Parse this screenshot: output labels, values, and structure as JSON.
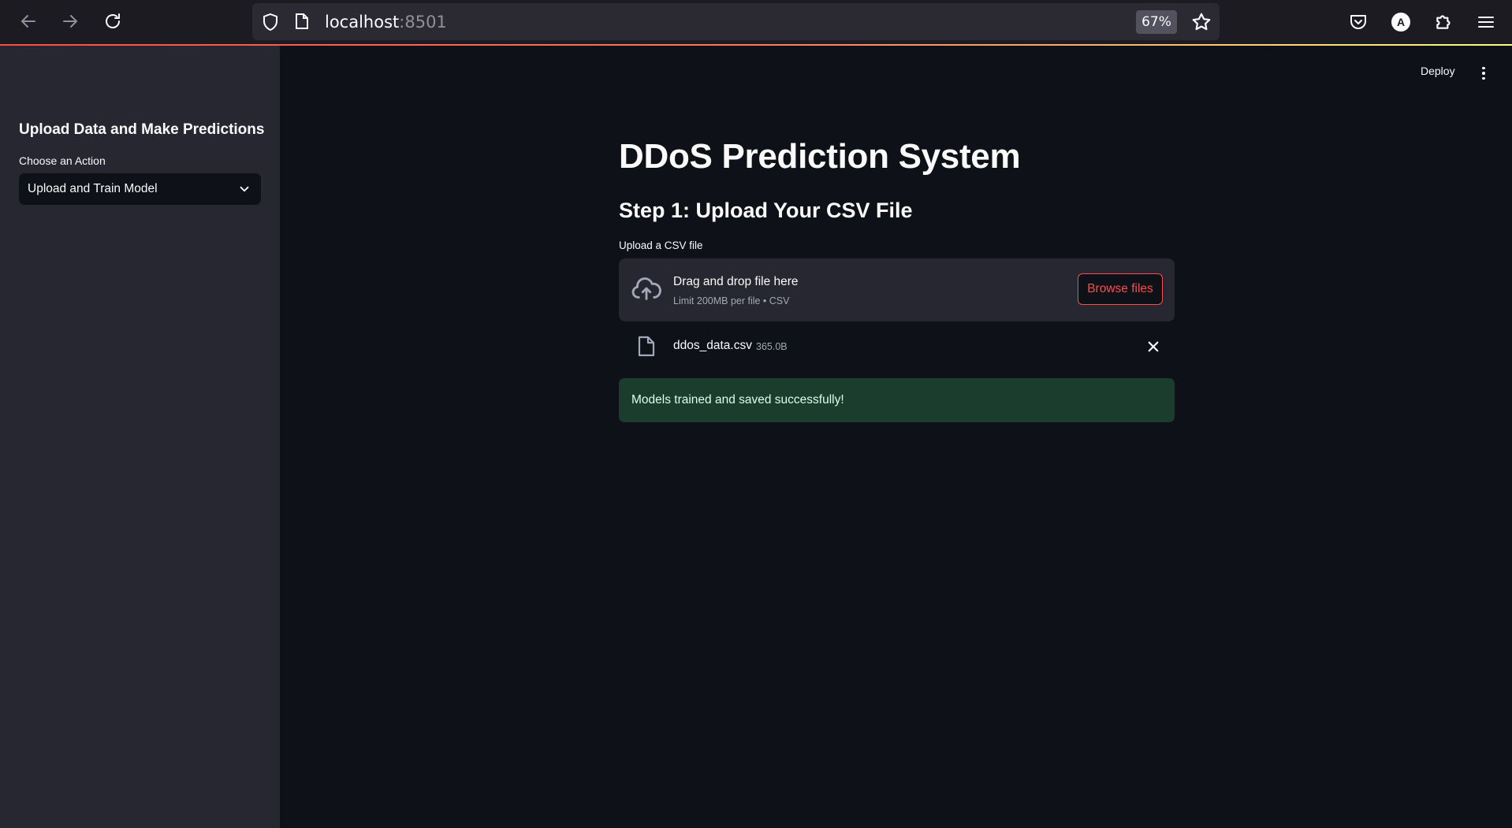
{
  "browser": {
    "url_host": "localhost",
    "url_port": ":8501",
    "zoom": "67%",
    "profile_initial": "A"
  },
  "sidebar": {
    "header": "Upload Data and Make Predictions",
    "select_label": "Choose an Action",
    "select_value": "Upload and Train Model"
  },
  "toolbar": {
    "deploy_label": "Deploy"
  },
  "main": {
    "title": "DDoS Prediction System",
    "step_heading": "Step 1: Upload Your CSV File",
    "uploader_label": "Upload a CSV file",
    "dropzone_title": "Drag and drop file here",
    "dropzone_limit": "Limit 200MB per file • CSV",
    "browse_label": "Browse files",
    "uploaded_file": {
      "name": "ddos_data.csv",
      "size": "365.0B"
    },
    "success_message": "Models trained and saved successfully!"
  },
  "colors": {
    "background": "#0e1117",
    "sidebar": "#262730",
    "accent": "#ff4b4b",
    "success_bg": "#1b3d2e"
  }
}
